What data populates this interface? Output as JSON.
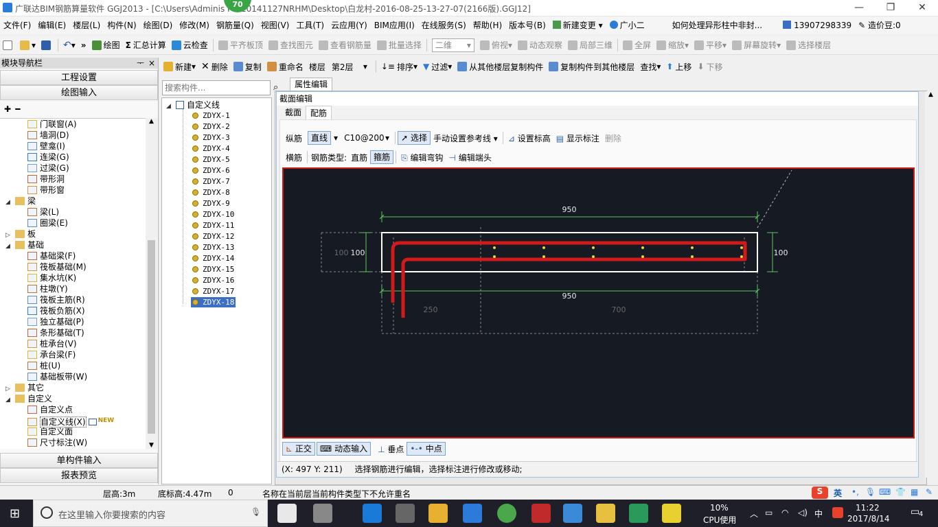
{
  "title": {
    "text": "广联达BIM钢筋算量软件 GGJ2013 - [C:\\Users\\Adminis          PC-20141127NRHM\\Desktop\\白龙村-2016-08-25-13-27-07(2166版).GGJ12]",
    "badge": "70",
    "min": "—",
    "max": "❐",
    "close": "✕"
  },
  "menu": [
    "文件(F)",
    "编辑(E)",
    "楼层(L)",
    "构件(N)",
    "绘图(D)",
    "修改(M)",
    "钢筋量(Q)",
    "视图(V)",
    "工具(T)",
    "云应用(Y)",
    "BIM应用(I)",
    "在线服务(S)",
    "帮助(H)",
    "版本号(B)",
    "新建变更",
    "广小二",
    "如何处理异形柱中非封...",
    "13907298339",
    "造价豆:0"
  ],
  "toolbar1": {
    "items": [
      "绘图",
      "汇总计算",
      "云检查",
      "平齐板顶",
      "查找图元",
      "查看钢筋量",
      "批量选择"
    ],
    "view_combo": "二维",
    "items2": [
      "俯视",
      "动态观察",
      "局部三维",
      "全屏",
      "缩放",
      "平移",
      "屏幕旋转",
      "选择楼层"
    ]
  },
  "panel": {
    "title": "模块导航栏",
    "pin": "ᅮ",
    "close": "×",
    "buttons": [
      "工程设置",
      "绘图输入"
    ],
    "bottom_buttons": [
      "单构件输入",
      "报表预览"
    ],
    "tree": [
      {
        "label": "门联窗(A)",
        "indent": 2
      },
      {
        "label": "墙洞(D)",
        "indent": 2
      },
      {
        "label": "壁龛(I)",
        "indent": 2
      },
      {
        "label": "连梁(G)",
        "indent": 2
      },
      {
        "label": "过梁(G)",
        "indent": 2
      },
      {
        "label": "带形洞",
        "indent": 2
      },
      {
        "label": "带形窗",
        "indent": 2
      },
      {
        "label": "梁",
        "indent": 1,
        "folder": true,
        "open": true
      },
      {
        "label": "梁(L)",
        "indent": 2
      },
      {
        "label": "圈梁(E)",
        "indent": 2
      },
      {
        "label": "板",
        "indent": 1,
        "folder": true,
        "open": false
      },
      {
        "label": "基础",
        "indent": 1,
        "folder": true,
        "open": true
      },
      {
        "label": "基础梁(F)",
        "indent": 2
      },
      {
        "label": "筏板基础(M)",
        "indent": 2
      },
      {
        "label": "集水坑(K)",
        "indent": 2
      },
      {
        "label": "柱墩(Y)",
        "indent": 2
      },
      {
        "label": "筏板主筋(R)",
        "indent": 2
      },
      {
        "label": "筏板负筋(X)",
        "indent": 2
      },
      {
        "label": "独立基础(P)",
        "indent": 2
      },
      {
        "label": "条形基础(T)",
        "indent": 2
      },
      {
        "label": "桩承台(V)",
        "indent": 2
      },
      {
        "label": "承台梁(F)",
        "indent": 2
      },
      {
        "label": "桩(U)",
        "indent": 2
      },
      {
        "label": "基础板带(W)",
        "indent": 2
      },
      {
        "label": "其它",
        "indent": 1,
        "folder": true,
        "open": false
      },
      {
        "label": "自定义",
        "indent": 1,
        "folder": true,
        "open": true
      },
      {
        "label": "自定义点",
        "indent": 2
      },
      {
        "label": "自定义线(X)",
        "indent": 2,
        "new": "NEW"
      },
      {
        "label": "自定义面",
        "indent": 2
      },
      {
        "label": "尺寸标注(W)",
        "indent": 2
      }
    ]
  },
  "toolbar2": {
    "new": "新建",
    "delete": "删除",
    "copy": "复制",
    "rename": "重命名",
    "floor_label": "楼层",
    "floor": "第2层",
    "sort": "排序",
    "filter": "过滤",
    "copy_from": "从其他楼层复制构件",
    "copy_to": "复制构件到其他楼层",
    "find": "查找",
    "up": "上移",
    "down": "下移"
  },
  "search": {
    "placeholder": "搜索构件..."
  },
  "components": {
    "root": "自定义线",
    "items": [
      "ZDYX-1",
      "ZDYX-2",
      "ZDYX-3",
      "ZDYX-4",
      "ZDYX-5",
      "ZDYX-6",
      "ZDYX-7",
      "ZDYX-8",
      "ZDYX-9",
      "ZDYX-10",
      "ZDYX-11",
      "ZDYX-12",
      "ZDYX-13",
      "ZDYX-14",
      "ZDYX-15",
      "ZDYX-16",
      "ZDYX-17",
      "ZDYX-18"
    ],
    "selected": "ZDYX-18"
  },
  "prop_tab": "属性编辑",
  "dialog": {
    "title": "截面编辑",
    "tabs": [
      "截面",
      "配筋"
    ],
    "active_tab": "配筋",
    "row1": {
      "label": "纵筋",
      "mode": "直线",
      "spec": "C10@200",
      "select": "选择",
      "ref": "手动设置参考线",
      "set_height": "设置标高",
      "show_label": "显示标注",
      "delete": "删除"
    },
    "row2": {
      "label": "横筋",
      "type_label": "钢筋类型:",
      "straight": "直筋",
      "stirrup": "箍筋",
      "edit_hook": "编辑弯钩",
      "edit_end": "编辑端头"
    },
    "dims": {
      "top": "950",
      "bottom": "950",
      "left_inner": "100",
      "left_outer": "100",
      "right": "100",
      "seg1": "250",
      "seg2": "700"
    },
    "snap": [
      "正交",
      "动态输入",
      "垂点",
      "中点"
    ],
    "coord": "(X: 497 Y: 211)",
    "hint": "选择钢筋进行编辑，选择标注进行修改或移动;"
  },
  "status": {
    "floor_height": "层高:3m",
    "base_height": "底标高:4.47m",
    "value": "0",
    "message": "名称在当前层当前构件类型下不允许重名"
  },
  "taskbar": {
    "search_placeholder": "在这里输入你要搜索的内容",
    "cpu_pct": "10%",
    "cpu_label": "CPU使用",
    "time": "11:22",
    "date": "2017/8/14",
    "ime": "中",
    "notif": "4",
    "tray_ime": "英"
  },
  "colors": {
    "accent": "#2b7bd8",
    "rebar": "#d21a1a",
    "canvas": "#161a22",
    "dim": "#5fc85f",
    "highlight": "#3a6fc4"
  }
}
